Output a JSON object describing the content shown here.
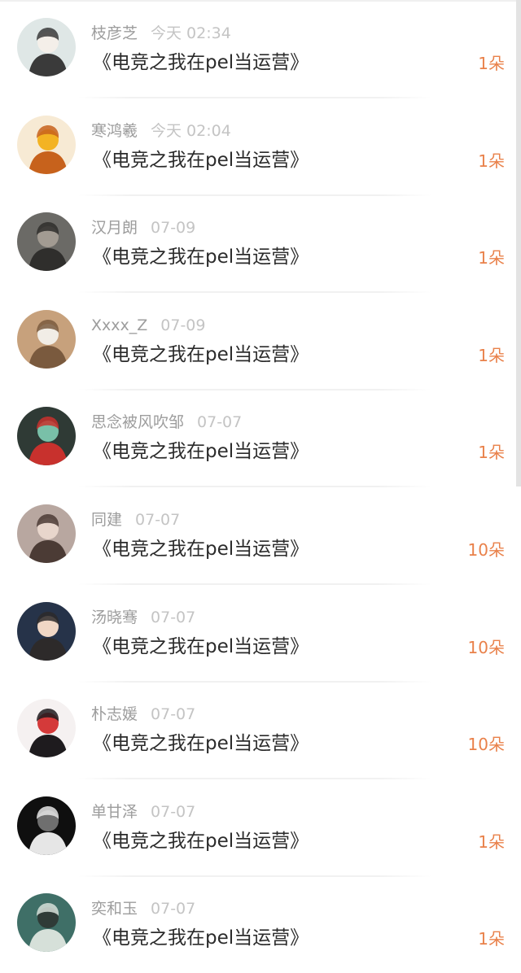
{
  "items": [
    {
      "name": "枝彦芝",
      "time": "今天 02:34",
      "title": "《电竞之我在pel当运营》",
      "flowers": "1朵",
      "avatar_icon": "avatar-girl-portrait",
      "avatar_colors": [
        "#dfe7e6",
        "#3a3a3a",
        "#f4efe9"
      ]
    },
    {
      "name": "寒鸿羲",
      "time": "今天 02:04",
      "title": "《电竞之我在pel当运营》",
      "flowers": "1朵",
      "avatar_icon": "avatar-autumn-trees",
      "avatar_colors": [
        "#f7ead4",
        "#c7621c",
        "#f3b323"
      ]
    },
    {
      "name": "汉月朗",
      "time": "07-09",
      "title": "《电竞之我在pel当运营》",
      "flowers": "1朵",
      "avatar_icon": "avatar-dark-figure",
      "avatar_colors": [
        "#6b6a66",
        "#2f2e2c",
        "#a29b92"
      ]
    },
    {
      "name": "Xxxx_Z",
      "time": "07-09",
      "title": "《电竞之我在pel当运营》",
      "flowers": "1朵",
      "avatar_icon": "avatar-cat-in-box",
      "avatar_colors": [
        "#c7a17c",
        "#7a5a3e",
        "#f1ede6"
      ]
    },
    {
      "name": "思念被风吹邹",
      "time": "07-07",
      "title": "《电竞之我在pel当运营》",
      "flowers": "1朵",
      "avatar_icon": "avatar-masked-character",
      "avatar_colors": [
        "#2f3a35",
        "#c8312d",
        "#79c0a8"
      ]
    },
    {
      "name": "同建",
      "time": "07-07",
      "title": "《电竞之我在pel当运营》",
      "flowers": "10朵",
      "avatar_icon": "avatar-woman-portrait",
      "avatar_colors": [
        "#b8a7a0",
        "#4b3b35",
        "#e8d6cc"
      ]
    },
    {
      "name": "汤晓骞",
      "time": "07-07",
      "title": "《电竞之我在pel当运营》",
      "flowers": "10朵",
      "avatar_icon": "avatar-boy-night",
      "avatar_colors": [
        "#263349",
        "#2d2a2a",
        "#f0d7c5"
      ]
    },
    {
      "name": "朴志媛",
      "time": "07-07",
      "title": "《电竞之我在pel当运营》",
      "flowers": "10朵",
      "avatar_icon": "avatar-girl-red",
      "avatar_colors": [
        "#f5f1f1",
        "#1e1b1e",
        "#d43a3a"
      ]
    },
    {
      "name": "单甘泽",
      "time": "07-07",
      "title": "《电竞之我在pel当运营》",
      "flowers": "1朵",
      "avatar_icon": "avatar-bw-figure",
      "avatar_colors": [
        "#0f0f0f",
        "#e6e6e6",
        "#6f6f6f"
      ]
    },
    {
      "name": "奕和玉",
      "time": "07-07",
      "title": "《电竞之我在pel当运营》",
      "flowers": "1朵",
      "avatar_icon": "avatar-street-scene",
      "avatar_colors": [
        "#3f6f67",
        "#d6e0d9",
        "#2f3b37"
      ]
    }
  ],
  "theme": {
    "flower_color": "#e9814a",
    "name_color": "#9d9d9d",
    "time_color": "#c4c4c4",
    "title_color": "#2b2b2b"
  }
}
